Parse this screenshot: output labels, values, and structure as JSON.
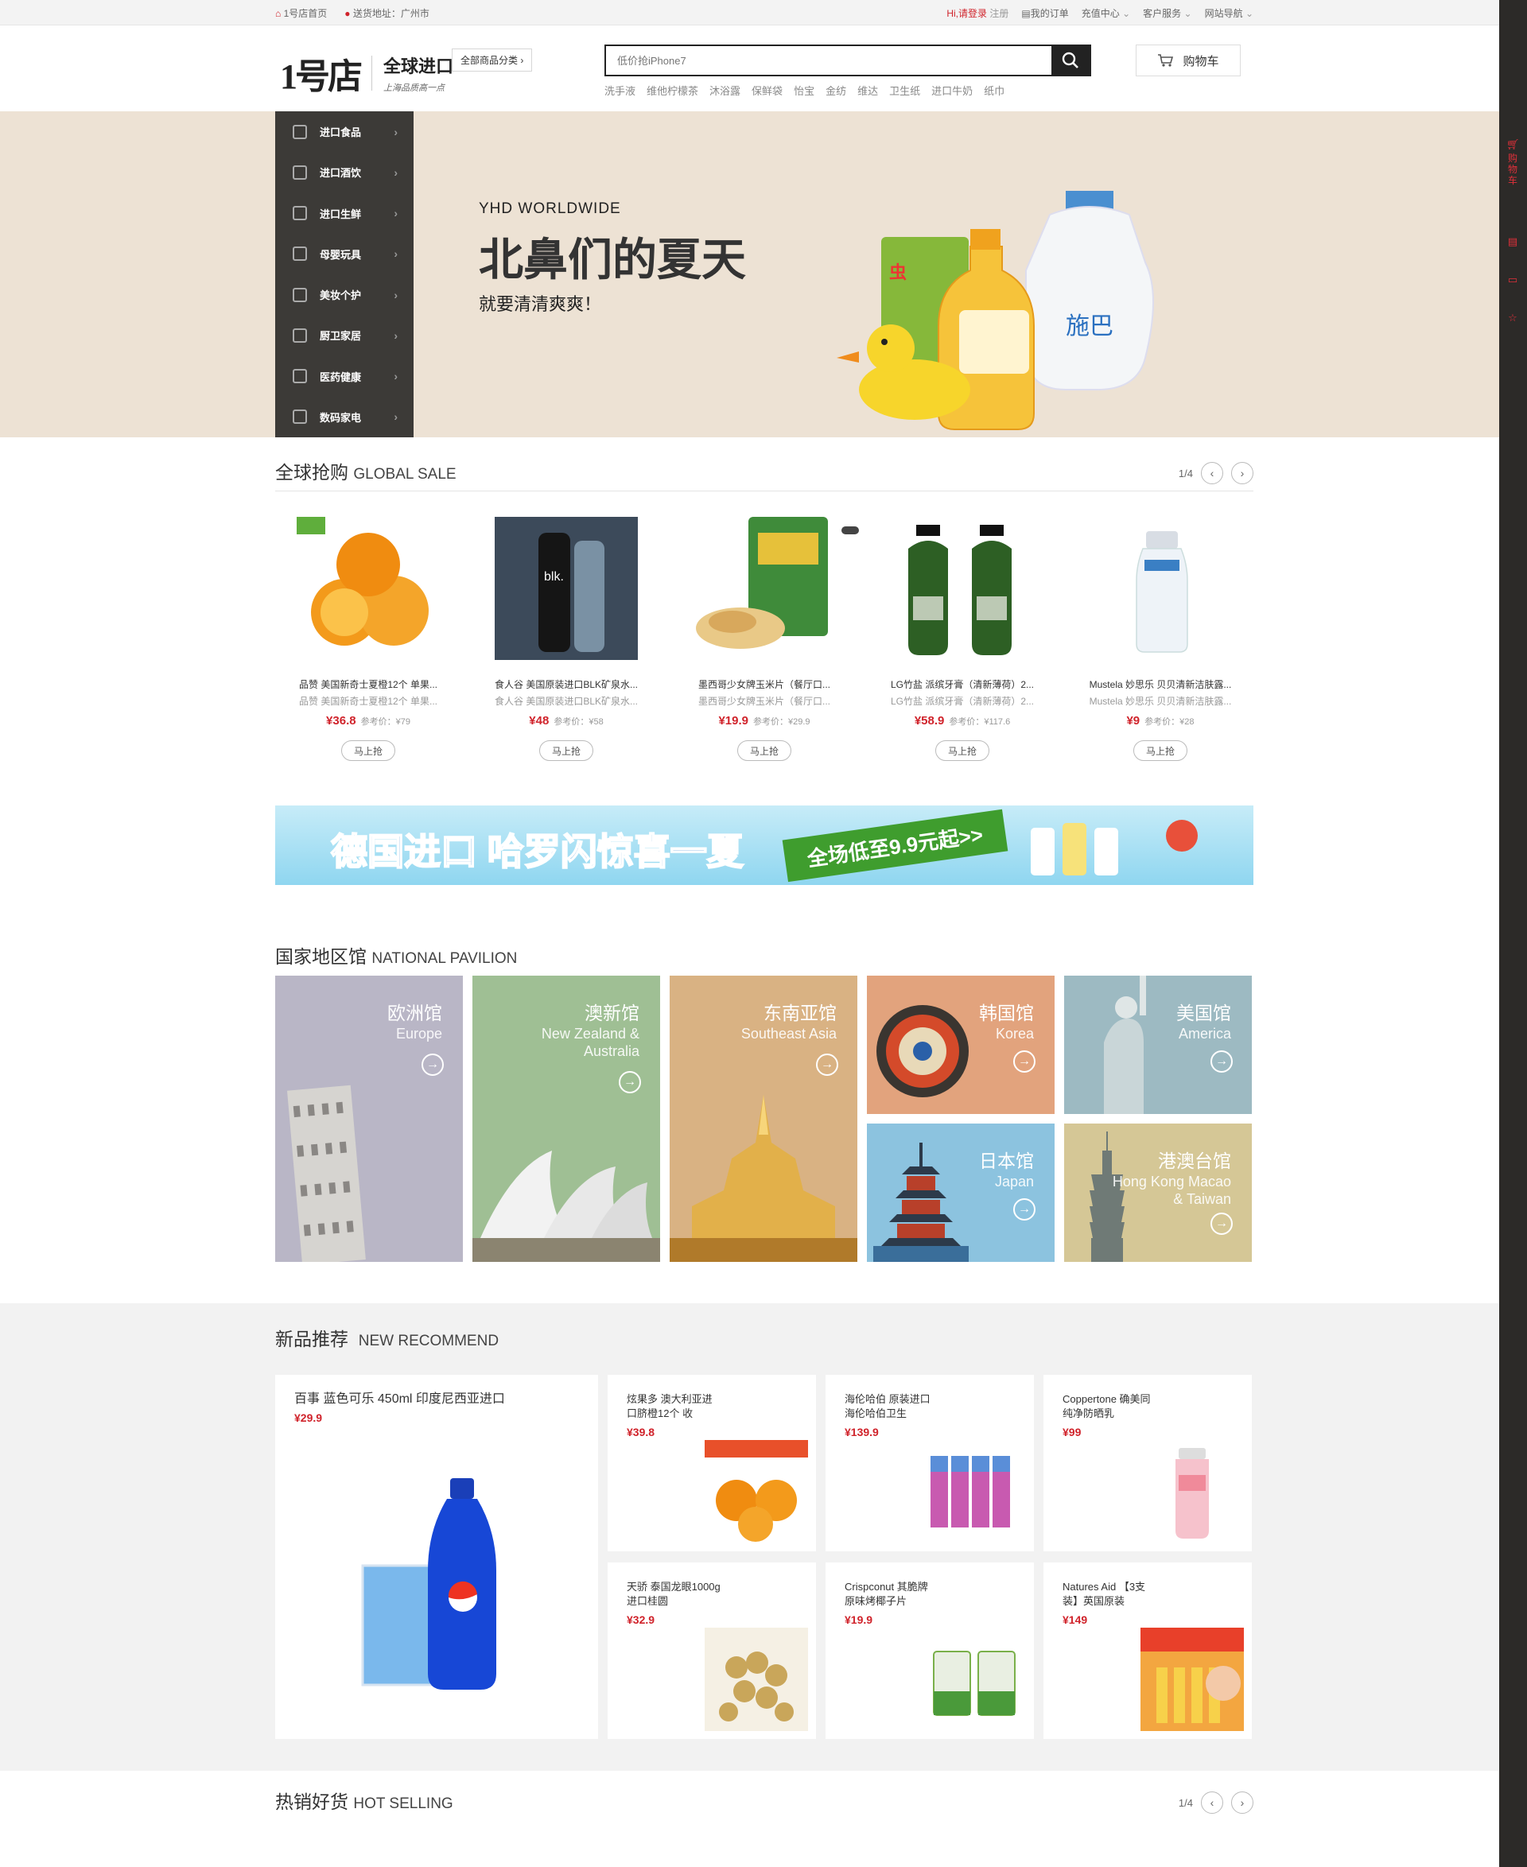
{
  "topbar": {
    "home": "1号店首页",
    "address": "送货地址：广州市",
    "greeting": "Hi,请登录",
    "register": "注册",
    "orders": "我的订单",
    "recharge": "充值中心",
    "service": "客户服务",
    "sitenav": "网站导航"
  },
  "header": {
    "logo_mark": "1号店",
    "title": "全球进口",
    "slogan": "上海品质高一点",
    "all_categories": "全部商品分类",
    "search_placeholder": "低价抢iPhone7",
    "hotwords": [
      "洗手液",
      "维他柠檬茶",
      "沐浴露",
      "保鲜袋",
      "怡宝",
      "金纺",
      "维达",
      "卫生纸",
      "进口牛奶",
      "纸巾"
    ],
    "cart": "购物车"
  },
  "categories": [
    "进口食品",
    "进口酒饮",
    "进口生鲜",
    "母婴玩具",
    "美妆个护",
    "厨卫家居",
    "医药健康",
    "数码家电"
  ],
  "banner": {
    "en": "YHD WORLDWIDE",
    "headline": "北鼻们的夏天",
    "sub": "就要清清爽爽！",
    "slides": 6,
    "active": 5
  },
  "global_sale": {
    "title": "全球抢购",
    "title_en": "GLOBAL SALE",
    "page": "1/4",
    "button": "马上抢",
    "items": [
      {
        "name": "品赞 美国新奇士夏橙12个 单果...",
        "name2": "品赞 美国新奇士夏橙12个 单果...",
        "price": "¥36.8",
        "ref": "参考价：¥79"
      },
      {
        "name": "食人谷 美国原装进口BLK矿泉水...",
        "name2": "食人谷 美国原装进口BLK矿泉水...",
        "price": "¥48",
        "ref": "参考价：¥58"
      },
      {
        "name": "墨西哥少女牌玉米片（餐厅口...",
        "name2": "墨西哥少女牌玉米片（餐厅口...",
        "price": "¥19.9",
        "ref": "参考价：¥29.9"
      },
      {
        "name": "LG竹盐 派缤牙膏（清新薄荷）2...",
        "name2": "LG竹盐 派缤牙膏（清新薄荷）2...",
        "price": "¥58.9",
        "ref": "参考价：¥117.6"
      },
      {
        "name": "Mustela 妙思乐 贝贝清新洁肤露...",
        "name2": "Mustela 妙思乐 贝贝清新洁肤露...",
        "price": "¥9",
        "ref": "参考价：¥28"
      }
    ]
  },
  "promo": {
    "headline": "德国进口 哈罗闪惊喜一夏",
    "ribbon": "全场低至9.9元起>>"
  },
  "pavilion": {
    "title": "国家地区馆",
    "title_en": "NATIONAL PAVILION",
    "items": [
      {
        "zh": "欧洲馆",
        "en": "Europe",
        "color": "#b9b6c6"
      },
      {
        "zh": "澳新馆",
        "en": "New Zealand & Australia",
        "color": "#9fbf94"
      },
      {
        "zh": "东南亚馆",
        "en": "Southeast Asia",
        "color": "#d9b283"
      },
      {
        "zh": "韩国馆",
        "en": "Korea",
        "color": "#e2a37d"
      },
      {
        "zh": "美国馆",
        "en": "America",
        "color": "#9dbac2"
      },
      {
        "zh": "日本馆",
        "en": "Japan",
        "color": "#8cc3df"
      },
      {
        "zh": "港澳台馆",
        "en": "Hong Kong Macao & Taiwan",
        "color": "#d5c796"
      }
    ]
  },
  "new_recommend": {
    "title": "新品推荐",
    "title_en": "NEW RECOMMEND",
    "items": [
      {
        "name": "百事 蓝色可乐 450ml 印度尼西亚进口",
        "price": "¥29.9"
      },
      {
        "name": "炫果多 澳大利亚进口脐橙12个 收",
        "price": "¥39.8"
      },
      {
        "name": "海伦哈伯 原装进口海伦哈伯卫生",
        "price": "¥139.9"
      },
      {
        "name": "Coppertone 确美同 纯净防晒乳",
        "price": "¥99"
      },
      {
        "name": "天骄 泰国龙眼1000g 进口桂圆",
        "price": "¥32.9"
      },
      {
        "name": "Crispconut 其脆牌 原味烤椰子片",
        "price": "¥19.9"
      },
      {
        "name": "Natures Aid 【3支装】英国原装",
        "price": "¥149"
      }
    ]
  },
  "hot_selling": {
    "title": "热销好货",
    "title_en": "HOT SELLING",
    "page": "1/4"
  },
  "rightbar": {
    "cart": "购物车"
  }
}
